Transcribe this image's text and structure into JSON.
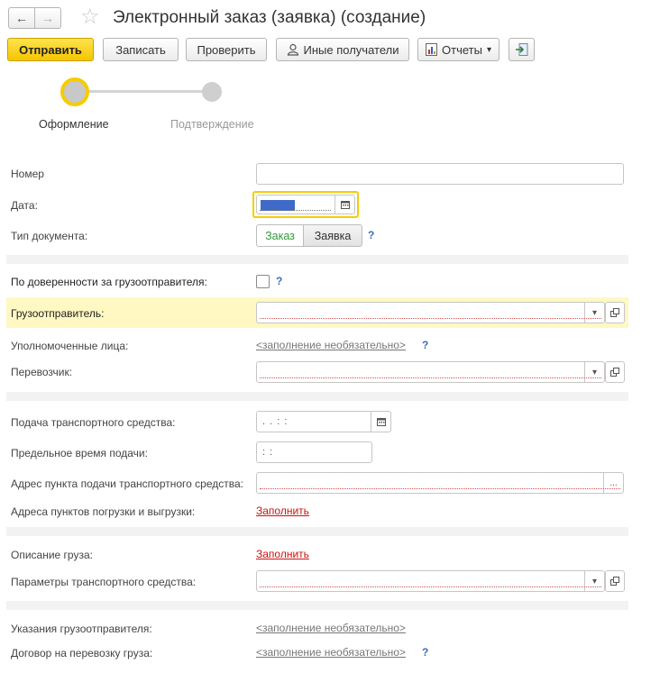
{
  "window": {
    "title": "Электронный заказ (заявка) (создание)"
  },
  "toolbar": {
    "send": "Отправить",
    "save": "Записать",
    "check": "Проверить",
    "recipients": "Иные получатели",
    "reports": "Отчеты",
    "reports_arrow": "▾"
  },
  "steps": [
    {
      "label": "Оформление",
      "active": true
    },
    {
      "label": "Подтверждение",
      "active": false
    }
  ],
  "form": {
    "number_label": "Номер",
    "number_value": "",
    "date_label": "Дата:",
    "doc_type_label": "Тип документа:",
    "doc_type_options": [
      "Заказ",
      "Заявка"
    ],
    "doc_type_selected": "Заказ",
    "attorney_label": "По доверенности за грузоотправителя:",
    "attorney_checked": false,
    "shipper_label": "Грузоотправитель:",
    "authorized_label": "Уполномоченные лица:",
    "carrier_label": "Перевозчик:",
    "vehicle_supply_label": "Подача транспортного средства:",
    "vehicle_supply_mask": ". .     :  :",
    "deadline_label": "Предельное время подачи:",
    "deadline_mask": " :  :",
    "supply_address_label": "Адрес пункта подачи транспортного средства:",
    "load_addresses_label": "Адреса пунктов погрузки и выгрузки:",
    "cargo_label": "Описание груза:",
    "vehicle_params_label": "Параметры транспортного средства:",
    "shipper_instructions_label": "Указания грузоотправителя:",
    "contract_label": "Договор на перевозку груза:"
  },
  "links": {
    "optional": "<заполнение необязательно>",
    "fill": "Заполнить"
  },
  "help": "?",
  "icons": {
    "back": "←",
    "forward": "→",
    "star": "☆",
    "dropdown": "▾",
    "ellipsis": "..."
  },
  "colors": {
    "primary_button": "#f5c500",
    "highlight_row": "#fff8c2",
    "active_step": "#f5cc00",
    "required_link": "#cc1111",
    "help_link": "#3a6fb8",
    "selected_option": "#2e9b3a"
  }
}
